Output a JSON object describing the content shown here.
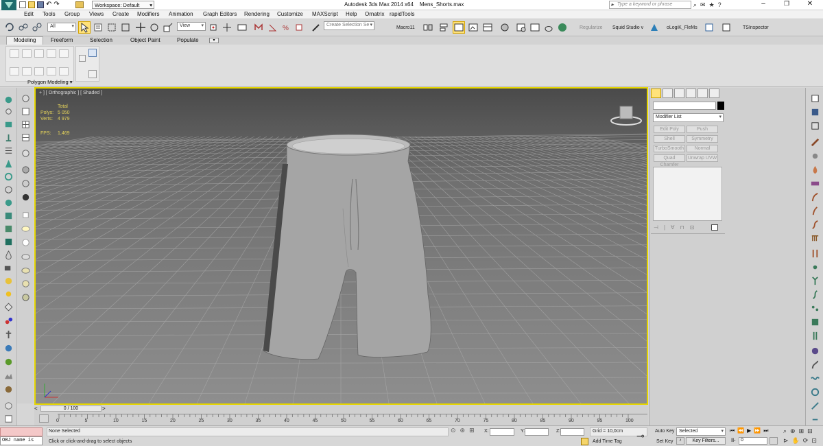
{
  "titlebar": {
    "workspace": "Workspace: Default",
    "app_title": "Autodesk 3ds Max  2014 x64",
    "file_name": "Mens_Shorts.max",
    "search_placeholder": "Type a keyword or phrase"
  },
  "menu": [
    "Edit",
    "Tools",
    "Group",
    "Views",
    "Create",
    "Modifiers",
    "Animation",
    "Graph Editors",
    "Rendering",
    "Customize",
    "MAXScript",
    "Help",
    "Ornatrix",
    "rapidTools"
  ],
  "toolbar": {
    "filter": "All",
    "ref_coord": "View",
    "selection_set": "Create Selection Se",
    "macro": "Macro11",
    "regularize": "Regularize",
    "squid": "Squid Studio v",
    "logik": "oLogiK_FleMs",
    "tsinspector": "TSInspector"
  },
  "ribbon": {
    "tabs": [
      "Modeling",
      "Freeform",
      "Selection",
      "Object Paint",
      "Populate"
    ],
    "active_tab": "Modeling",
    "panel_label": "Polygon Modeling"
  },
  "viewport": {
    "label": "+ ] [ Orthographic ] [ Shaded ]",
    "stats_header": "Total",
    "polys_label": "Polys:",
    "polys_value": "5 050",
    "verts_label": "Verts:",
    "verts_value": "4 979",
    "fps_label": "FPS:",
    "fps_value": "1,469"
  },
  "cmdpanel": {
    "modifier_list": "Modifier List",
    "modifiers": [
      "Edit Poly",
      "Push",
      "Shell",
      "Symmetry",
      "TurboSmooth",
      "Normal",
      "Quad Chamfer",
      "Unwrap UVW"
    ]
  },
  "timeline": {
    "frame_counter": "0 / 100",
    "ticks": [
      "0",
      "5",
      "10",
      "15",
      "20",
      "25",
      "30",
      "35",
      "40",
      "45",
      "50",
      "55",
      "60",
      "65",
      "70",
      "75",
      "80",
      "85",
      "90",
      "95",
      "100"
    ]
  },
  "status": {
    "maxscript": "OBJ name is",
    "selection": "None Selected",
    "prompt": "Click or click-and-drag to select objects",
    "x_label": "X:",
    "y_label": "Y:",
    "z_label": "Z:",
    "grid": "Grid = 10,0cm",
    "add_time_tag": "Add Time Tag",
    "auto_key": "Auto Key",
    "set_key": "Set Key",
    "selected": "Selected",
    "key_filters": "Key Filters...",
    "frame": "0"
  },
  "colors": {
    "viewport_border": "#e6d600",
    "stats_text": "#e6d45a",
    "active_button": "#ffe27a"
  }
}
